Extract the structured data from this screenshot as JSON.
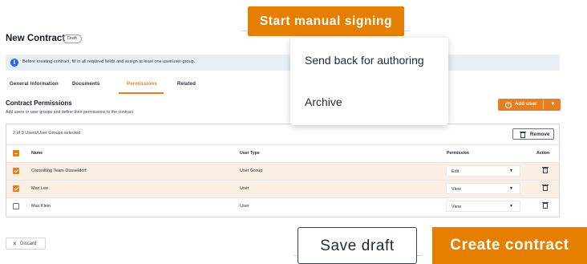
{
  "page": {
    "title": "New Contract",
    "badge": "Draft"
  },
  "info": {
    "text": "Before creating contract, fill in all required fields and assign at least one user/user group."
  },
  "tabs": [
    {
      "label": "General Information",
      "active": false
    },
    {
      "label": "Documents",
      "active": false
    },
    {
      "label": "Permissions",
      "active": true
    },
    {
      "label": "Related",
      "active": false
    }
  ],
  "section": {
    "title": "Contract Permissions",
    "subtitle": "Add users or user groups and define their permissions to the contract."
  },
  "add_user": {
    "label": "Add user"
  },
  "table": {
    "selected_text": "2 of 3 Users/User Groups selected",
    "remove_label": "Remove",
    "headers": {
      "name": "Name",
      "type": "User Type",
      "permission": "Permission",
      "action": "Action"
    },
    "rows": [
      {
        "name": "Consulting Team Düsseldorf",
        "type": "User Group",
        "permission": "Edit",
        "checked": true
      },
      {
        "name": "Max Lee",
        "type": "User",
        "permission": "View",
        "checked": true
      },
      {
        "name": "Max Klein",
        "type": "User",
        "permission": "View",
        "checked": false
      }
    ]
  },
  "footer": {
    "discard": "Discard",
    "save_draft": "Save draft",
    "create": "Create contract"
  },
  "overlay": {
    "start_signing": "Start manual signing",
    "menu": [
      "Send back for authoring",
      "Archive"
    ]
  },
  "colors": {
    "accent": "#e67e22",
    "info_bg": "#e8eef4",
    "selected_row": "#fbeee2"
  },
  "icons": {
    "info": "info-icon",
    "add": "plus-circle-icon",
    "caret": "chevron-down-icon",
    "trash": "trash-icon",
    "close": "close-icon"
  }
}
